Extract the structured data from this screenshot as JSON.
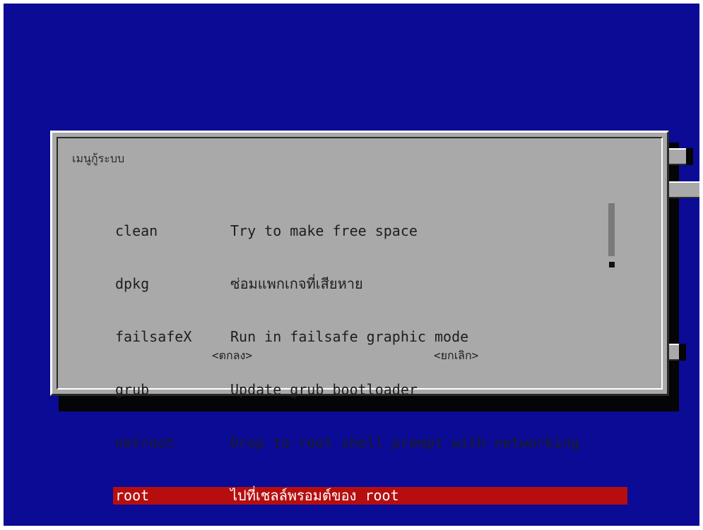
{
  "dialog": {
    "title": "เมนูกู้ระบบ"
  },
  "menu": {
    "items": [
      {
        "tag": "clean",
        "description": "Try to make free space"
      },
      {
        "tag": "dpkg",
        "description": "ซ่อมแพกเกจที่เสียหาย"
      },
      {
        "tag": "failsafeX",
        "description": "Run in failsafe graphic mode"
      },
      {
        "tag": "grub",
        "description": "Update grub bootloader"
      },
      {
        "tag": "netroot",
        "description": "Drop to root shell prompt with networking"
      },
      {
        "tag": "root",
        "description": "ไปที่เชลล์พรอมต์ของ root"
      }
    ],
    "selected_index": 5
  },
  "buttons": {
    "ok_label": "<ตกลง>",
    "cancel_label": "<ยกเลิก>"
  },
  "scroll": {
    "up_arrow": "↑"
  },
  "colors": {
    "screen_background": "#0b0b96",
    "dialog_background": "#a9a9a9",
    "selection": "#b60e0e",
    "shadow": "#050505"
  }
}
